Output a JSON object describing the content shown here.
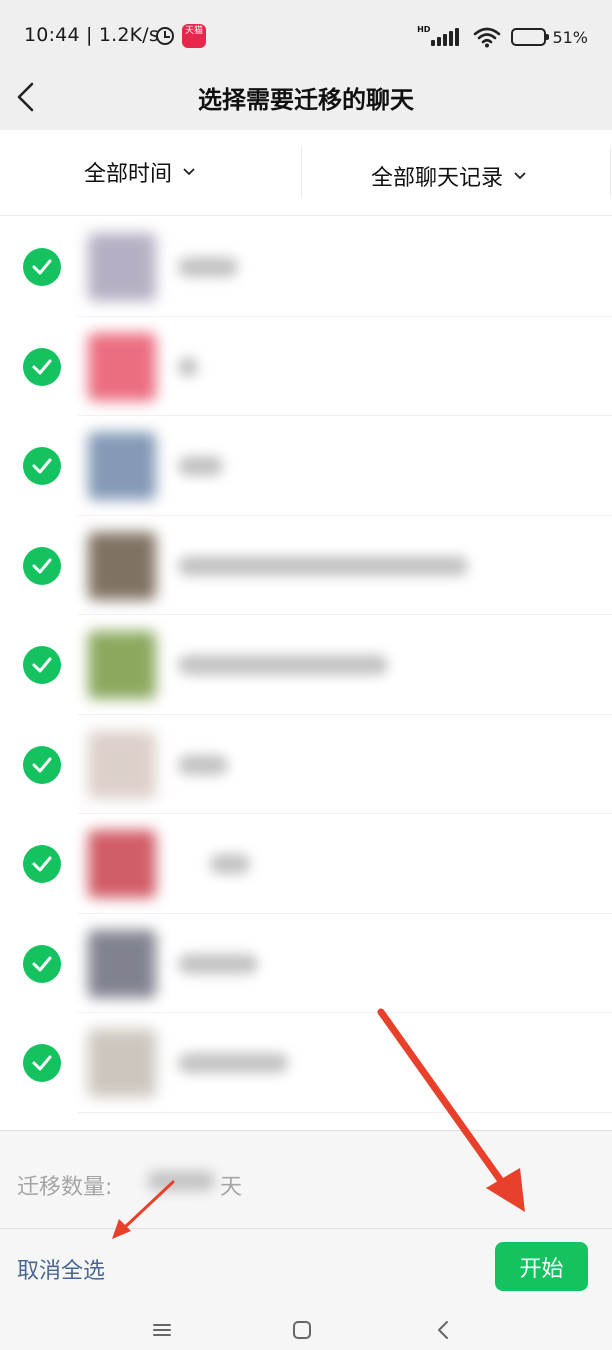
{
  "status_bar": {
    "time": "10:44 | 1.2K/s",
    "app_badge": "天猫",
    "network_badge": "HD",
    "battery_percent": "51%",
    "battery_level": 0.51
  },
  "header": {
    "title": "选择需要迁移的聊天",
    "back_icon": "back-chevron-icon"
  },
  "filters": {
    "time_label": "全部时间",
    "records_label": "全部聊天记录"
  },
  "chats": [
    {
      "checked": true,
      "avatar_color": "#a9a2b9"
    },
    {
      "checked": true,
      "avatar_color": "#e8546b"
    },
    {
      "checked": true,
      "avatar_color": "#6f88aa"
    },
    {
      "checked": true,
      "avatar_color": "#6b5a48"
    },
    {
      "checked": true,
      "avatar_color": "#789a44"
    },
    {
      "checked": true,
      "avatar_color": "#d7c8c2"
    },
    {
      "checked": true,
      "avatar_color": "#c9414e"
    },
    {
      "checked": true,
      "avatar_color": "#6b6e7c"
    },
    {
      "checked": true,
      "avatar_color": "#c4bdb4"
    }
  ],
  "footer": {
    "count_label": "迁移数量:",
    "count_suffix": "天",
    "deselect_all": "取消全选",
    "start": "开始"
  },
  "colors": {
    "accent_green": "#14c360",
    "link_blue": "#4a6793",
    "annotation_red": "#e8402a"
  }
}
